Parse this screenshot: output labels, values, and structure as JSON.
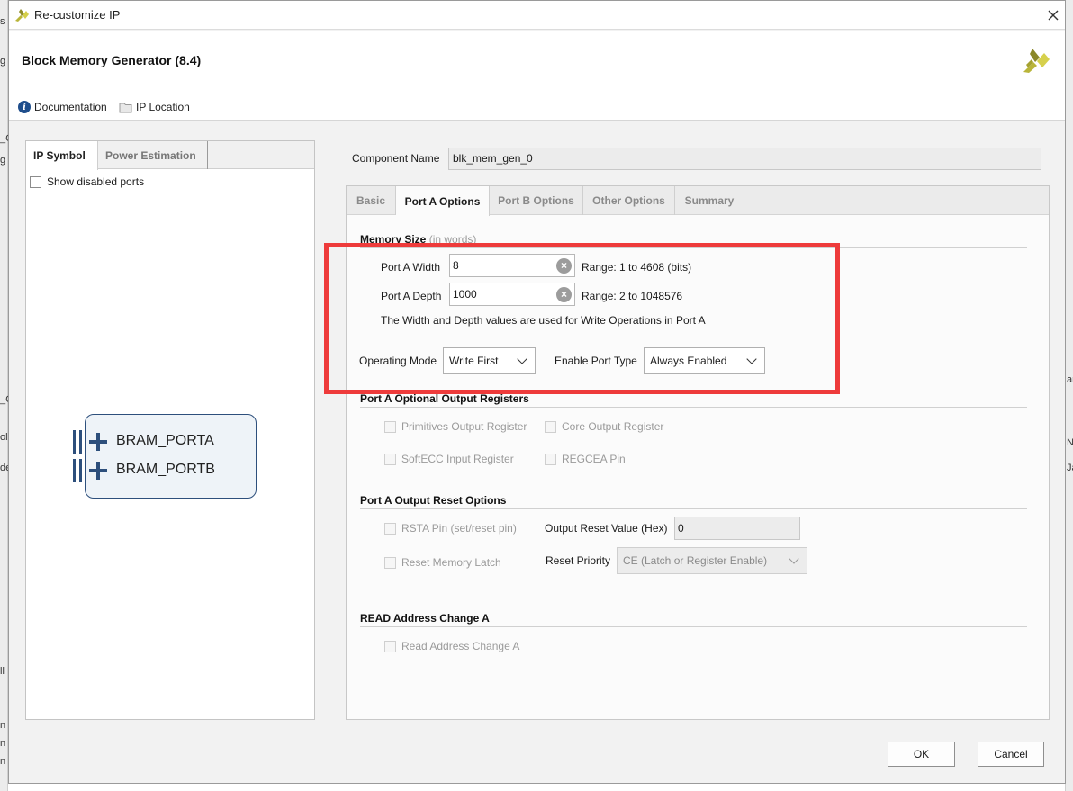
{
  "background_app": {
    "left_fragments": [
      "s",
      "g",
      "_C",
      "g",
      "_C",
      "ol",
      "de",
      "ll",
      "n",
      "n",
      "n"
    ],
    "right_fragments": [
      "ar",
      "N",
      "Ja"
    ]
  },
  "dialog": {
    "title": "Re-customize IP",
    "header_title": "Block Memory Generator (8.4)",
    "links": {
      "documentation": "Documentation",
      "ip_location": "IP Location"
    }
  },
  "left_panel": {
    "tabs": [
      "IP Symbol",
      "Power Estimation"
    ],
    "active_tab": "IP Symbol",
    "show_disabled_ports_label": "Show disabled ports",
    "ports": [
      "BRAM_PORTA",
      "BRAM_PORTB"
    ]
  },
  "component_name": {
    "label": "Component Name",
    "value": "blk_mem_gen_0"
  },
  "config_tabs": [
    "Basic",
    "Port A Options",
    "Port B Options",
    "Other Options",
    "Summary"
  ],
  "active_config_tab": "Port A Options",
  "memory_size": {
    "title": "Memory Size",
    "title_suffix": "(in words)",
    "width_label": "Port A Width",
    "width_value": "8",
    "width_range": "Range: 1 to 4608 (bits)",
    "depth_label": "Port A Depth",
    "depth_value": "1000",
    "depth_range": "Range: 2 to 1048576",
    "note": "The Width and Depth values are used for Write Operations in Port A",
    "operating_mode_label": "Operating Mode",
    "operating_mode_value": "Write First",
    "enable_port_type_label": "Enable Port Type",
    "enable_port_type_value": "Always Enabled"
  },
  "optional_output_registers": {
    "title": "Port A Optional Output Registers",
    "primitives_output_register": "Primitives Output Register",
    "core_output_register": "Core Output Register",
    "softecc_input_register": "SoftECC Input Register",
    "regcea_pin": "REGCEA Pin"
  },
  "output_reset_options": {
    "title": "Port A Output Reset Options",
    "rsta_pin": "RSTA Pin (set/reset pin)",
    "output_reset_value_label": "Output Reset Value (Hex)",
    "output_reset_value": "0",
    "reset_memory_latch": "Reset Memory Latch",
    "reset_priority_label": "Reset Priority",
    "reset_priority_value": "CE (Latch or Register Enable)"
  },
  "read_address_change": {
    "title": "READ Address Change A",
    "checkbox_label": "Read Address Change A"
  },
  "buttons": {
    "ok": "OK",
    "cancel": "Cancel"
  },
  "colors": {
    "highlight": "#ee3b3b",
    "port_blue": "#2d4f7c",
    "xilinx_logo": "#c9c23a"
  }
}
